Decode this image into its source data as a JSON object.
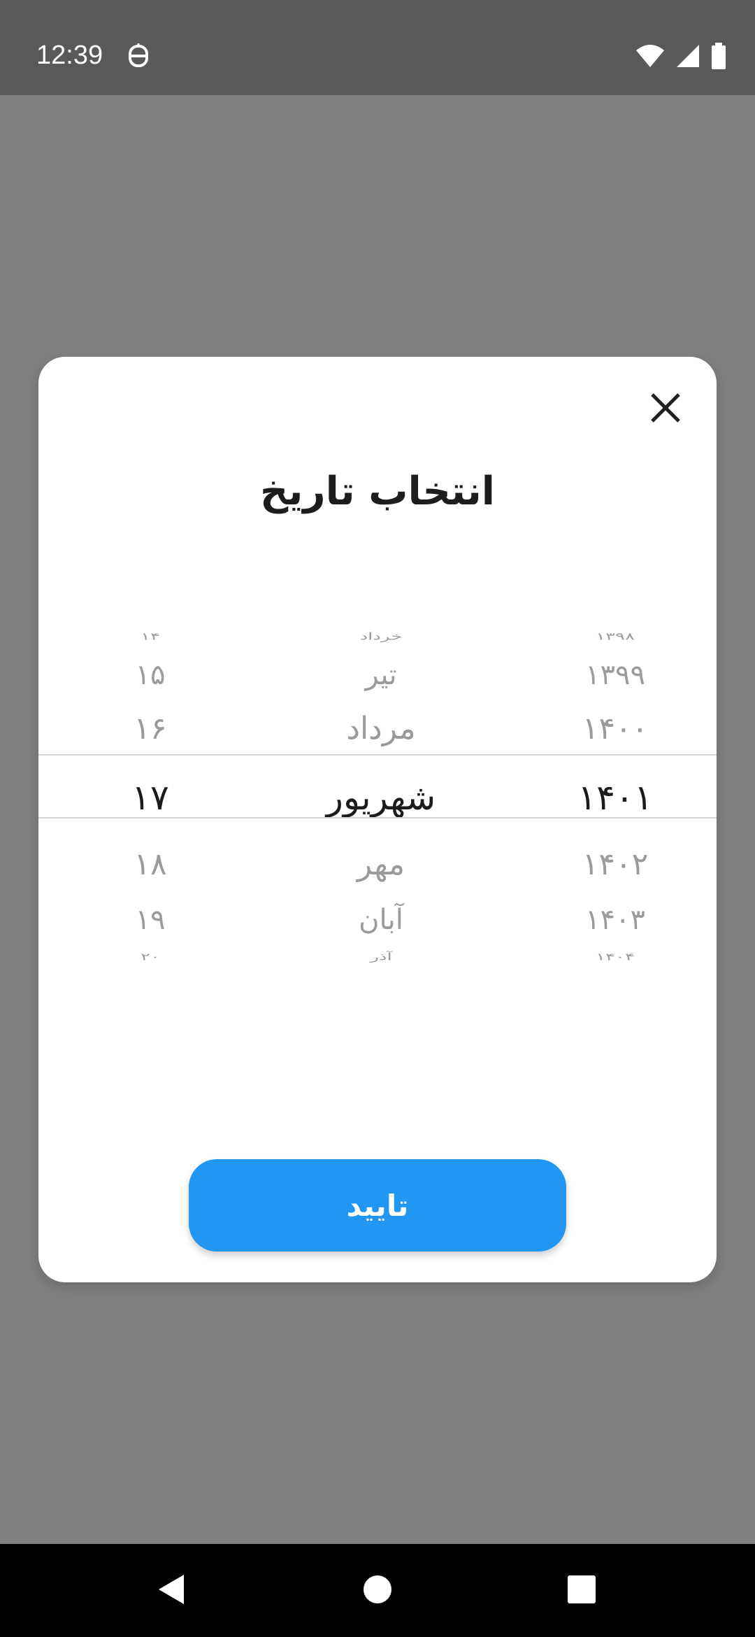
{
  "status_bar": {
    "time": "12:39",
    "icons": [
      "app-notification-icon",
      "wifi-icon",
      "cell-signal-icon",
      "battery-icon"
    ]
  },
  "dialog": {
    "title": "انتخاب تاریخ",
    "close_icon": "close-icon",
    "confirm_label": "تایید"
  },
  "picker": {
    "selected": {
      "day": "۱۷",
      "month": "شهریور",
      "year": "۱۴۰۱"
    },
    "rows": [
      {
        "day": "۱۴",
        "month": "خرداد",
        "year": "۱۳۹۸"
      },
      {
        "day": "۱۵",
        "month": "تیر",
        "year": "۱۳۹۹"
      },
      {
        "day": "۱۶",
        "month": "مرداد",
        "year": "۱۴۰۰"
      },
      {
        "day": "۱۷",
        "month": "شهریور",
        "year": "۱۴۰۱"
      },
      {
        "day": "۱۸",
        "month": "مهر",
        "year": "۱۴۰۲"
      },
      {
        "day": "۱۹",
        "month": "آبان",
        "year": "۱۴۰۳"
      },
      {
        "day": "۲۰",
        "month": "آذر",
        "year": "۱۴۰۴"
      }
    ]
  },
  "nav_bar": {
    "icons": [
      "back-icon",
      "home-icon",
      "recents-icon"
    ]
  },
  "colors": {
    "scrim": "#808080",
    "status_bar": "#595959",
    "accent": "#2196f3",
    "selected_text": "#1b1b1b",
    "faded_text": "#9b9b9b"
  }
}
